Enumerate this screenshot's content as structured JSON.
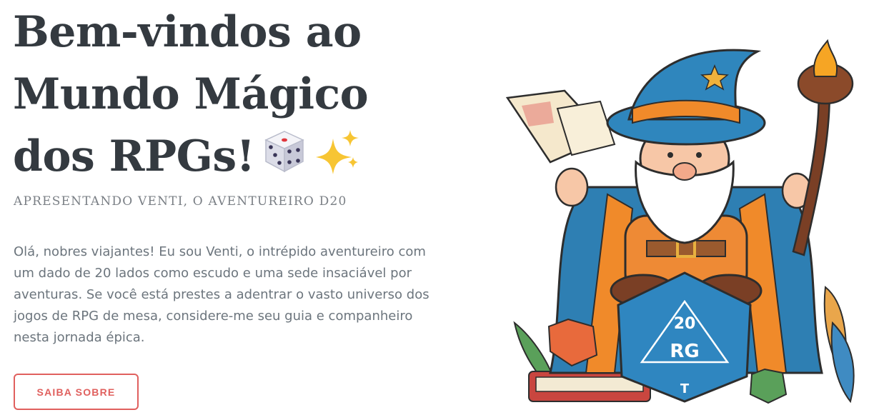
{
  "hero": {
    "title_lines": [
      "Bem-vindos ao",
      "Mundo Mágico",
      "dos RPGs!"
    ],
    "title_emojis": [
      "dice-icon",
      "sparkles-icon"
    ],
    "subtitle": "APRESENTANDO VENTI, O AVENTUREIRO D20",
    "intro_lines": [
      "Olá, nobres viajantes! Eu sou Venti, o intrépido aventureiro com",
      "um dado de 20 lados como escudo e uma sede insaciável por",
      "aventuras. Se você está prestes a adentrar o vasto universo dos",
      "jogos de RPG de mesa, considere-me seu guia e companheiro",
      "nesta jornada épica."
    ],
    "cta_label": "SAIBA SOBRE"
  },
  "illustration": {
    "subject": "wizard-mascot-on-d20",
    "d20_text": [
      "20",
      "RG",
      "T"
    ],
    "colors": {
      "robe_blue": "#2e7fb3",
      "hat_blue": "#2f86bd",
      "orange": "#f08a2a",
      "accent_red": "#e0605e",
      "title_text": "#343a40",
      "body_text": "#6c757d"
    }
  }
}
